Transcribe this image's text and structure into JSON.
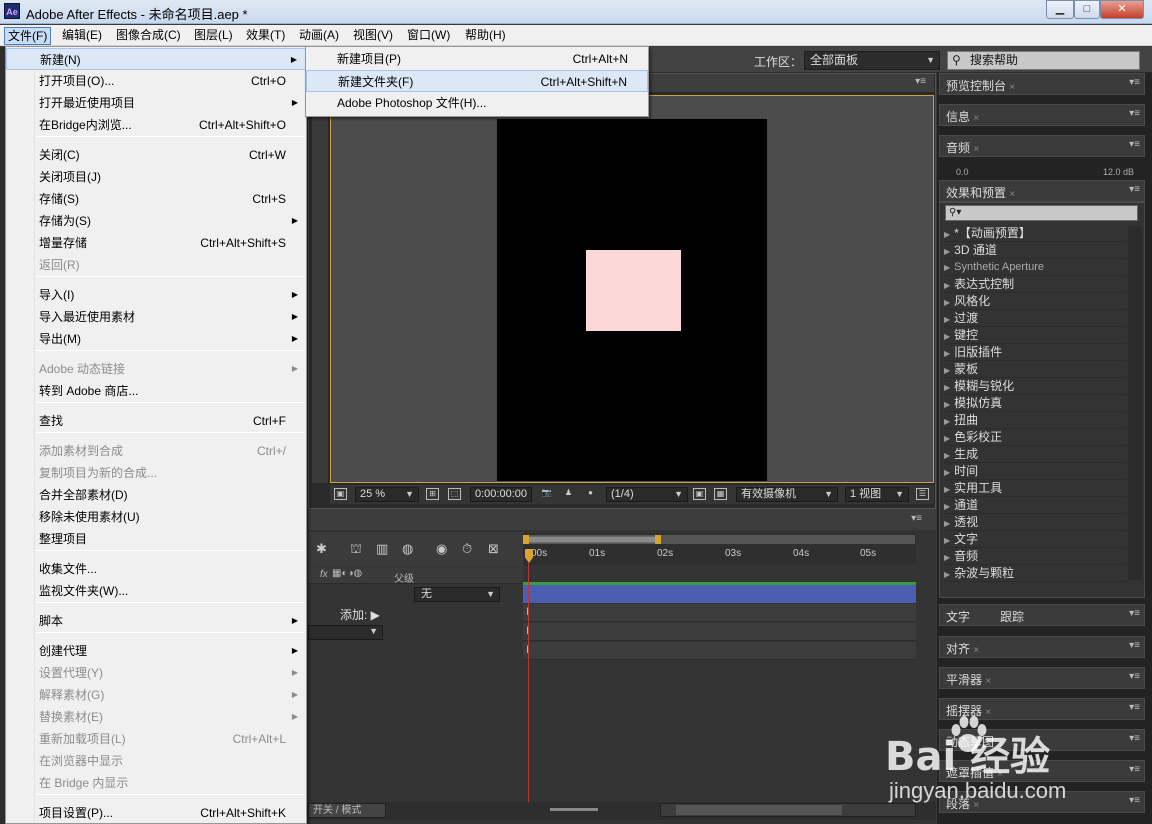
{
  "window": {
    "app_icon": "Ae",
    "title": "Adobe After Effects - 未命名项目.aep *",
    "controls": {
      "minimize": "▁",
      "maximize": "□",
      "close": "✕"
    }
  },
  "menubar": {
    "items": [
      "文件(F)",
      "编辑(E)",
      "图像合成(C)",
      "图层(L)",
      "效果(T)",
      "动画(A)",
      "视图(V)",
      "窗口(W)",
      "帮助(H)"
    ]
  },
  "toolbar": {
    "workspace_label": "工作区：",
    "workspace_value": "全部面板",
    "help_search_placeholder": "搜索帮助"
  },
  "file_menu": {
    "items": [
      {
        "label": "新建(N)",
        "shortcut": "",
        "submenu": true,
        "disabled": false,
        "highlighted": true
      },
      {
        "label": "打开项目(O)...",
        "shortcut": "Ctrl+O",
        "submenu": false,
        "disabled": false
      },
      {
        "label": "打开最近使用项目",
        "shortcut": "",
        "submenu": true,
        "disabled": false
      },
      {
        "label": "在Bridge内浏览...",
        "shortcut": "Ctrl+Alt+Shift+O",
        "submenu": false,
        "disabled": false
      },
      {
        "label": "关闭(C)",
        "shortcut": "Ctrl+W",
        "submenu": false,
        "disabled": false
      },
      {
        "label": "关闭项目(J)",
        "shortcut": "",
        "submenu": false,
        "disabled": false
      },
      {
        "label": "存储(S)",
        "shortcut": "Ctrl+S",
        "submenu": false,
        "disabled": false
      },
      {
        "label": "存储为(S)",
        "shortcut": "",
        "submenu": true,
        "disabled": false
      },
      {
        "label": "增量存储",
        "shortcut": "Ctrl+Alt+Shift+S",
        "submenu": false,
        "disabled": false
      },
      {
        "label": "返回(R)",
        "shortcut": "",
        "submenu": false,
        "disabled": true
      },
      {
        "label": "导入(I)",
        "shortcut": "",
        "submenu": true,
        "disabled": false
      },
      {
        "label": "导入最近使用素材",
        "shortcut": "",
        "submenu": true,
        "disabled": false
      },
      {
        "label": "导出(M)",
        "shortcut": "",
        "submenu": true,
        "disabled": false
      },
      {
        "label": "Adobe 动态链接",
        "shortcut": "",
        "submenu": true,
        "disabled": true
      },
      {
        "label": "转到 Adobe 商店...",
        "shortcut": "",
        "submenu": false,
        "disabled": false
      },
      {
        "label": "查找",
        "shortcut": "Ctrl+F",
        "submenu": false,
        "disabled": false
      },
      {
        "label": "添加素材到合成",
        "shortcut": "Ctrl+/",
        "submenu": false,
        "disabled": true
      },
      {
        "label": "复制项目为新的合成...",
        "shortcut": "",
        "submenu": false,
        "disabled": true
      },
      {
        "label": "合并全部素材(D)",
        "shortcut": "",
        "submenu": false,
        "disabled": false
      },
      {
        "label": "移除未使用素材(U)",
        "shortcut": "",
        "submenu": false,
        "disabled": false
      },
      {
        "label": "整理项目",
        "shortcut": "",
        "submenu": false,
        "disabled": false
      },
      {
        "label": "收集文件...",
        "shortcut": "",
        "submenu": false,
        "disabled": false
      },
      {
        "label": "监视文件夹(W)...",
        "shortcut": "",
        "submenu": false,
        "disabled": false
      },
      {
        "label": "脚本",
        "shortcut": "",
        "submenu": true,
        "disabled": false
      },
      {
        "label": "创建代理",
        "shortcut": "",
        "submenu": true,
        "disabled": false
      },
      {
        "label": "设置代理(Y)",
        "shortcut": "",
        "submenu": true,
        "disabled": true
      },
      {
        "label": "解释素材(G)",
        "shortcut": "",
        "submenu": true,
        "disabled": true
      },
      {
        "label": "替换素材(E)",
        "shortcut": "",
        "submenu": true,
        "disabled": true
      },
      {
        "label": "重新加载项目(L)",
        "shortcut": "Ctrl+Alt+L",
        "submenu": false,
        "disabled": true
      },
      {
        "label": "在浏览器中显示",
        "shortcut": "",
        "submenu": false,
        "disabled": true
      },
      {
        "label": "在 Bridge 内显示",
        "shortcut": "",
        "submenu": false,
        "disabled": true
      },
      {
        "label": "项目设置(P)...",
        "shortcut": "Ctrl+Alt+Shift+K",
        "submenu": false,
        "disabled": false
      }
    ]
  },
  "new_submenu": {
    "items": [
      {
        "label": "新建项目(P)",
        "shortcut": "Ctrl+Alt+N",
        "highlighted": false
      },
      {
        "label": "新建文件夹(F)",
        "shortcut": "Ctrl+Alt+Shift+N",
        "highlighted": true
      },
      {
        "label": "Adobe Photoshop 文件(H)...",
        "shortcut": "",
        "highlighted": false
      }
    ]
  },
  "viewer": {
    "zoom": "25 %",
    "timecode": "0:00:00:00",
    "resolution": "(1/4)",
    "camera": "有效摄像机",
    "views": "1 视图"
  },
  "timeline": {
    "ticks": [
      "00s",
      "01s",
      "02s",
      "03s",
      "04s",
      "05s"
    ],
    "column_parent": "父级",
    "parent_value": "无",
    "add_label": "添加:",
    "switch_mode_label": "开关 / 模式"
  },
  "right_panels": {
    "preview": "预览控制台",
    "info": "信息",
    "audio": "音频",
    "audio_left": "0.0",
    "audio_right": "12.0 dB",
    "effects": "效果和预置",
    "effects_search": "",
    "effects_items": [
      "*【动画预置】",
      "3D 通道",
      "Synthetic Aperture",
      "表达式控制",
      "风格化",
      "过渡",
      "键控",
      "旧版插件",
      "蒙板",
      "模糊与锐化",
      "模拟仿真",
      "扭曲",
      "色彩校正",
      "生成",
      "时间",
      "实用工具",
      "通道",
      "透视",
      "文字",
      "音频",
      "杂波与颗粒"
    ],
    "text_tab": "文字",
    "track_tab": "跟踪",
    "align": "对齐",
    "smoother": "平滑器",
    "wiggler": "摇摆器",
    "motion_sketch": "动态草图",
    "mask_interp": "遮罩插值",
    "paragraph": "段落"
  },
  "watermark": {
    "brand": "Bai  经验",
    "url": "jingyan.baidu.com"
  },
  "colors": {
    "accent_menu_highlight": "#dde8f7",
    "layer_bar": "#4a5fb0",
    "solid_layer": "#fcd8d8",
    "cti": "#d8a234",
    "cti_line": "#c23333"
  }
}
